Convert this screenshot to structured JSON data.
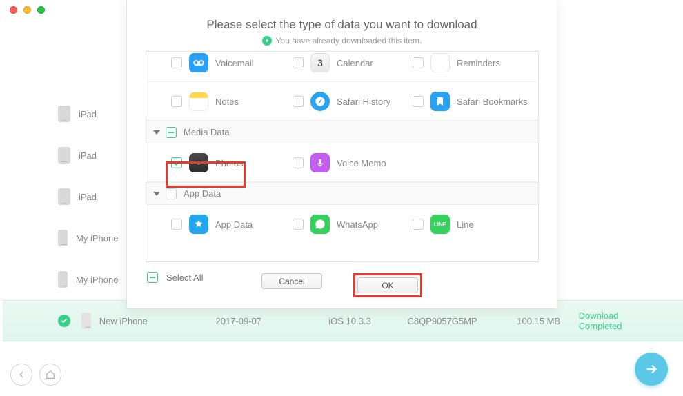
{
  "traffic_lights": {
    "red": "#ff5f57",
    "yellow": "#febc2e",
    "green": "#28c840"
  },
  "modal": {
    "title": "Please select the type of data you want to download",
    "subtitle": "You have already downloaded this item.",
    "groups": {
      "media": "Media Data",
      "app": "App Data"
    },
    "items": {
      "voicemail": "Voicemail",
      "calendar": "Calendar",
      "reminders": "Reminders",
      "notes": "Notes",
      "safari_history": "Safari History",
      "safari_bookmarks": "Safari Bookmarks",
      "photos": "Photos",
      "voice_memo": "Voice Memo",
      "app_data": "App Data",
      "whatsapp": "WhatsApp",
      "line": "Line"
    },
    "calendar_day": "3",
    "select_all": "Select All",
    "cancel": "Cancel",
    "ok": "OK"
  },
  "devices": {
    "d1": "iPad",
    "d2": "iPad",
    "d3": "iPad",
    "d4": "My iPhone",
    "d5": "My iPhone",
    "d6": "New iPhone"
  },
  "selected_row": {
    "date": "2017-09-07",
    "ios": "iOS 10.3.3",
    "serial": "C8QP9057G5MP",
    "size": "100.15 MB",
    "status": "Download Completed"
  }
}
